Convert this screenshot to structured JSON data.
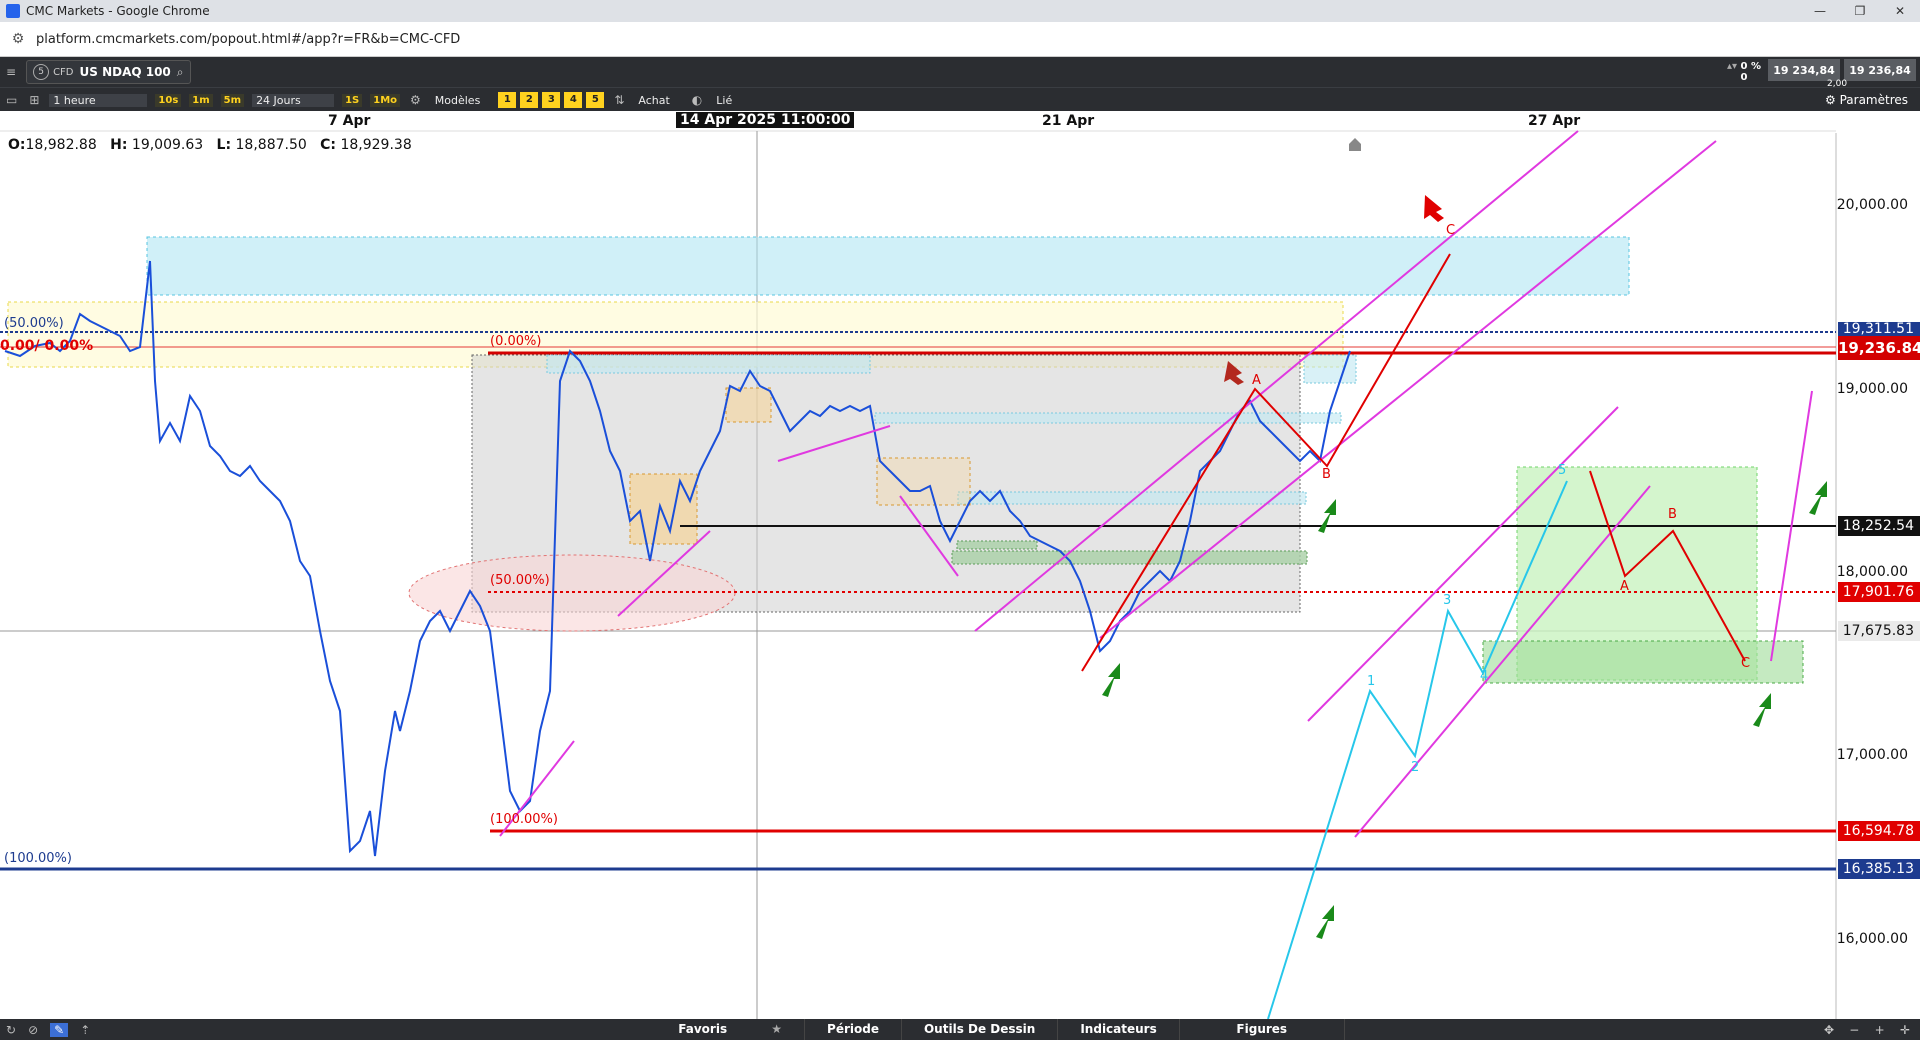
{
  "window": {
    "title": "CMC Markets - Google Chrome",
    "controls": [
      "—",
      "❐",
      "✕"
    ]
  },
  "address": {
    "url": "platform.cmcmarkets.com/popout.html#/app?r=FR&b=CMC-CFD"
  },
  "instrument": {
    "badge": "5",
    "type": "CFD",
    "name": "US NDAQ 100"
  },
  "quote": {
    "change_pct": "0 %",
    "change_val": "0",
    "sell": "19 234,84",
    "buy": "19 236,84",
    "spread": "2,00"
  },
  "toolbar": {
    "interval": "1 heure",
    "tf_buttons": [
      "10s",
      "1m",
      "5m"
    ],
    "range": "24 Jours",
    "tf_buttons2": [
      "1S",
      "1Mo"
    ],
    "models": "Modèles",
    "model_nums": [
      "1",
      "2",
      "3",
      "4",
      "5"
    ],
    "buy": "Achat",
    "linked": "Lié",
    "settings": "Paramètres"
  },
  "chart": {
    "dates": {
      "d1": "7 Apr",
      "cursor": "14 Apr 2025 11:00:00",
      "d2": "21 Apr",
      "d3": "27 Apr"
    },
    "ohlc": {
      "o_label": "O:",
      "o": "18,982.88",
      "h_label": "H:",
      "h": "19,009.63",
      "l_label": "L:",
      "l": "18,887.50",
      "c_label": "C:",
      "c": "18,929.38"
    },
    "axis": [
      "20,000.00",
      "19,000.00",
      "18,000.00",
      "17,000.00",
      "16,000.00"
    ],
    "price_tags": {
      "top_partial": "19,311.51",
      "current": "19,236.84",
      "black": "18,252.54",
      "red_50": "17,901.76",
      "gray": "17,675.83",
      "red_100": "16,594.78",
      "blue_100": "16,385.13"
    },
    "fib": {
      "blue50": "(50.00%)",
      "red0_left": "0.00",
      "red0_left2": "0.00%",
      "red0": "(0.00%)",
      "red50": "(50.00%)",
      "red100": "(100.00%)",
      "blue100": "(100.00%)"
    },
    "wave_labels": {
      "C_top": "C",
      "A_top": "A",
      "B_top": "B",
      "w1": "1",
      "w2": "2",
      "w3": "3",
      "w4": "4",
      "w5": "5",
      "A_r": "A",
      "B_r": "B",
      "C_r": "C"
    }
  },
  "bottom": {
    "tabs": [
      "Favoris",
      "Période",
      "Outils De Dessin",
      "Indicateurs",
      "Figures"
    ]
  }
}
